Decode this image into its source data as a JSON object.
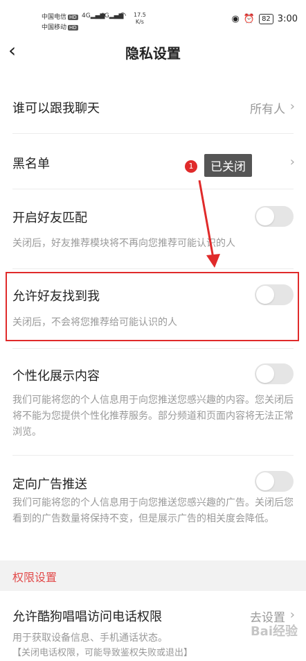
{
  "status": {
    "carrier1": "中国电信",
    "carrier2": "中国移动",
    "hd": "HD",
    "net1": "4G",
    "net2": "4G",
    "speed_value": "17.5",
    "speed_unit": "K/s",
    "battery": "82",
    "time": "3:00"
  },
  "nav": {
    "title": "隐私设置"
  },
  "rows": {
    "chat": {
      "label": "谁可以跟我聊天",
      "value": "所有人"
    },
    "blacklist": {
      "label": "黑名单"
    },
    "friend_match": {
      "label": "开启好友匹配",
      "desc": "关闭后，好友推荐模块将不再向您推荐可能认识的人"
    },
    "find_me": {
      "label": "允许好友找到我",
      "desc": "关闭后，不会将您推荐给可能认识的人"
    },
    "personalized": {
      "label": "个性化展示内容",
      "desc": "我们可能将您的个人信息用于向您推送您感兴趣的内容。您关闭后将不能为您提供个性化推荐服务。部分频道和页面内容将无法正常浏览。"
    },
    "ads": {
      "label": "定向广告推送",
      "desc": "我们可能将您的个人信息用于向您推送您感兴趣的广告。关闭后您看到的广告数量将保持不变，但是展示广告的相关度会降低。"
    }
  },
  "permissions": {
    "section_title": "权限设置",
    "phone": {
      "label": "允许酷狗唱唱访问电话权限",
      "value": "去设置",
      "desc": "用于获取设备信息、手机通话状态。",
      "desc2": "【关闭电话权限，可能导致鉴权失败或退出】"
    }
  },
  "annotation": {
    "step": "1",
    "tooltip": "已关闭",
    "color": "#e02a2a"
  },
  "watermark": "Bai经验"
}
